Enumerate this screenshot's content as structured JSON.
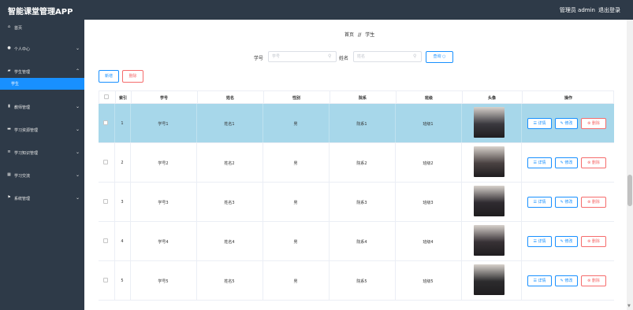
{
  "app": {
    "title": "智能课堂管理APP"
  },
  "topbar": {
    "user": "管理员 admin",
    "logout": "退出登录"
  },
  "sidebar": {
    "items": [
      {
        "icon": "home-icon",
        "label": "首页",
        "expandable": false
      },
      {
        "icon": "user-icon",
        "label": "个人中心",
        "expandable": true
      },
      {
        "icon": "student-icon",
        "label": "学生管理",
        "expandable": true
      },
      {
        "icon": "",
        "label": "学生",
        "expandable": false,
        "active": true
      },
      {
        "icon": "chart-icon",
        "label": "教师管理",
        "expandable": true
      },
      {
        "icon": "folder-icon",
        "label": "学习资源管理",
        "expandable": true
      },
      {
        "icon": "list-icon",
        "label": "学习知识管理",
        "expandable": true
      },
      {
        "icon": "grid-icon",
        "label": "学习交流",
        "expandable": true
      },
      {
        "icon": "flag-icon",
        "label": "系统管理",
        "expandable": true
      }
    ]
  },
  "breadcrumb": {
    "home": "首页",
    "separator": "//",
    "current": "学生"
  },
  "search": {
    "student_no_label": "学号",
    "student_no_placeholder": "学号",
    "name_label": "姓名",
    "name_placeholder": "姓名",
    "query_button": "查询 ○"
  },
  "actions": {
    "add": "新增",
    "delete": "删除"
  },
  "table": {
    "headers": [
      "索引",
      "学号",
      "姓名",
      "性别",
      "院系",
      "班级",
      "头像",
      "操作"
    ],
    "row_actions": {
      "detail": "☰ 详情",
      "edit": "✎ 修改",
      "delete": "⊗ 删除"
    },
    "rows": [
      {
        "index": "1",
        "student_no": "学号1",
        "name": "姓名1",
        "gender": "男",
        "department": "院系1",
        "class": "班级1",
        "selected": true
      },
      {
        "index": "2",
        "student_no": "学号2",
        "name": "姓名2",
        "gender": "男",
        "department": "院系2",
        "class": "班级2",
        "selected": false
      },
      {
        "index": "3",
        "student_no": "学号3",
        "name": "姓名3",
        "gender": "男",
        "department": "院系3",
        "class": "班级3",
        "selected": false
      },
      {
        "index": "4",
        "student_no": "学号4",
        "name": "姓名4",
        "gender": "男",
        "department": "院系4",
        "class": "班级4",
        "selected": false
      },
      {
        "index": "5",
        "student_no": "学号5",
        "name": "姓名5",
        "gender": "男",
        "department": "院系5",
        "class": "班级5",
        "selected": false
      }
    ]
  },
  "colors": {
    "sidebar_bg": "#2e3a48",
    "accent": "#1890ff",
    "danger": "#f56c6c",
    "selected_row": "#a7d7ea"
  }
}
